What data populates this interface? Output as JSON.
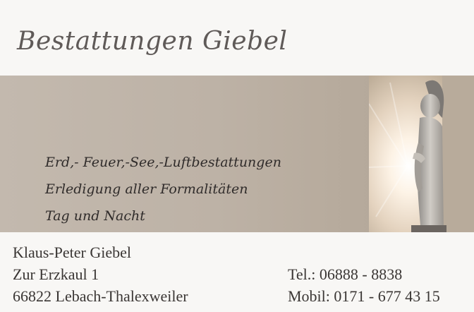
{
  "company": {
    "name": "Bestattungen Giebel"
  },
  "services": [
    "Erd,- Feuer,-See,-Luftbestattungen",
    "Erledigung aller Formalitäten",
    "Tag und Nacht"
  ],
  "address": {
    "person": "Klaus-Peter Giebel",
    "street": "Zur Erzkaul 1",
    "city": "66822 Lebach-Thalexweiler"
  },
  "phone": {
    "tel": "Tel.: 06888 - 8838",
    "mobil": "Mobil: 0171 - 677 43 15"
  },
  "colors": {
    "band": "#bdb2a6",
    "text": "#3a3634",
    "title": "#5f5a58"
  }
}
